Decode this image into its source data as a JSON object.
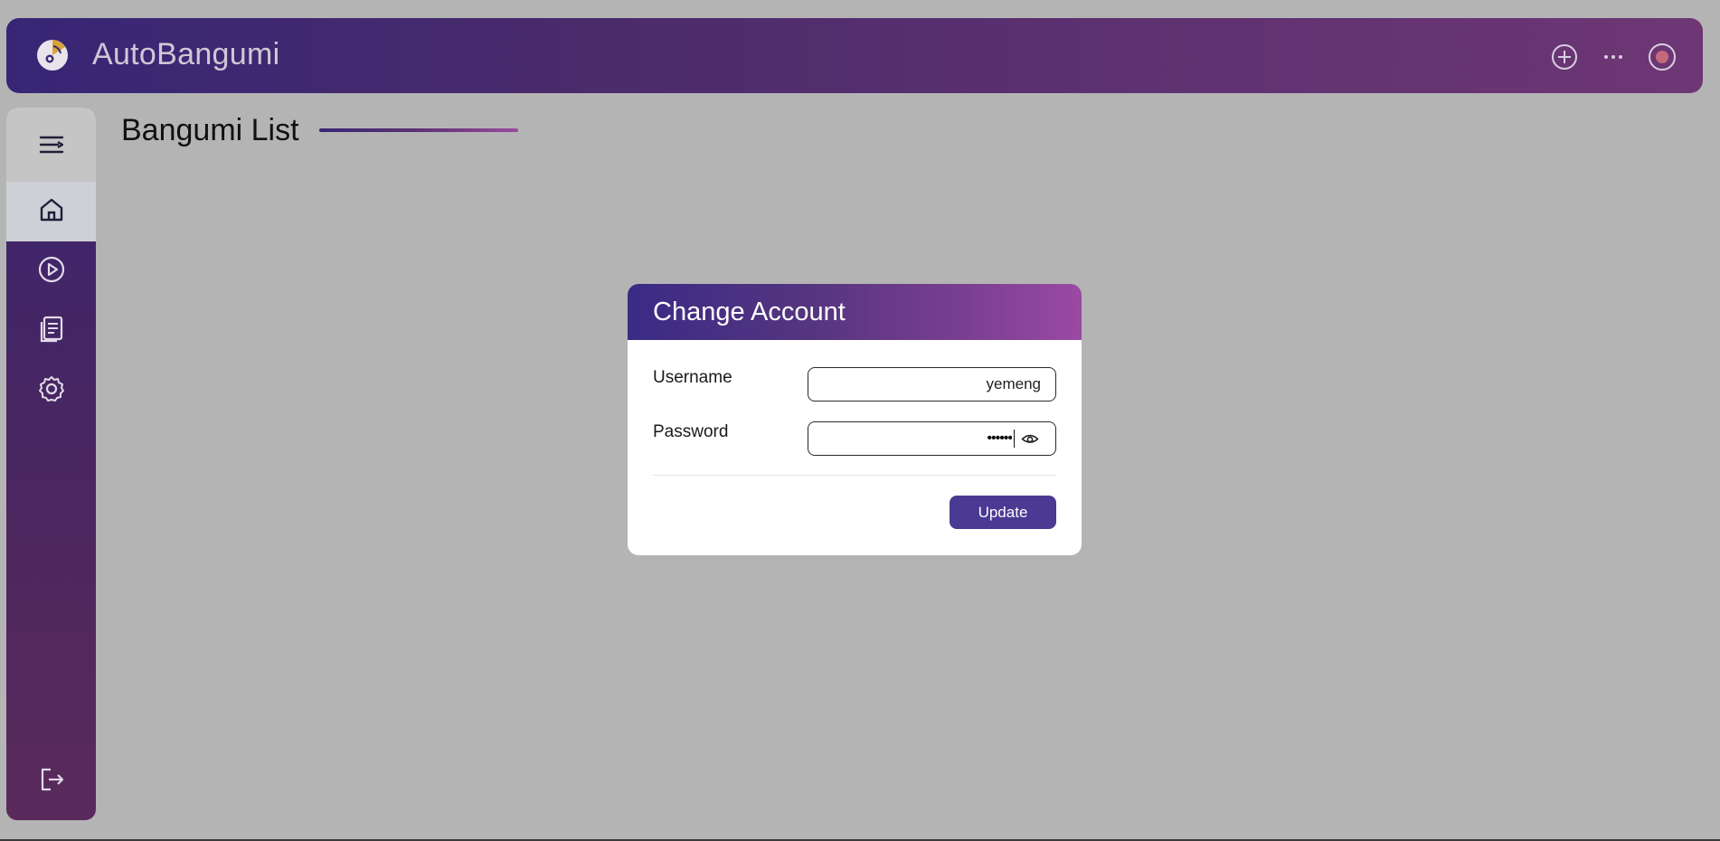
{
  "app": {
    "title": "AutoBangumi",
    "logo_icon": "autobangumi-logo-icon"
  },
  "topbar": {
    "actions": [
      {
        "name": "add-icon"
      },
      {
        "name": "more-icon"
      },
      {
        "name": "status-icon"
      }
    ]
  },
  "sidebar": {
    "toggle_icon": "menu-fold-icon",
    "items": [
      {
        "name": "home-icon",
        "active": true
      },
      {
        "name": "play-icon",
        "active": false
      },
      {
        "name": "log-icon",
        "active": false
      },
      {
        "name": "settings-icon",
        "active": false
      }
    ],
    "bottom_icon": "logout-icon"
  },
  "page": {
    "title": "Bangumi List"
  },
  "modal": {
    "title": "Change Account",
    "username_label": "Username",
    "username_value": "yemeng",
    "password_label": "Password",
    "password_value": "••••••",
    "update_label": "Update"
  },
  "colors": {
    "accent": "#4b3a93",
    "topbar_start": "#372676",
    "topbar_end": "#6e3675",
    "status_dot": "#c46a7a"
  }
}
